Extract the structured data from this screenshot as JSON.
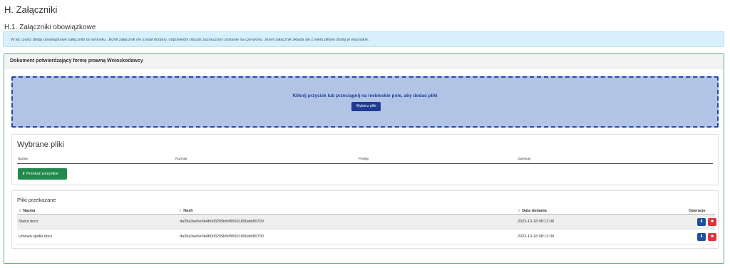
{
  "section": {
    "title": "H. Załączniki",
    "subtitle": "H.1. Załączniki obowiązkowe",
    "info": "W tej części dodaj obowiązkowe załączniki do wniosku. Jeżeli załącznik nie został dodany, odpowiedni obszar zaznaczony zostanie na czerwono. Jeżeli załącznik składa się z wielu plików dodaj je wszystkie."
  },
  "document": {
    "title": "Dokument potwierdzający formę prawną Wnioskodawcy",
    "dropzone_text": "Kliknij przycisk lub przeciągnij na niebieskie pole, aby dodać pliki",
    "choose_button": "Wybierz pliki"
  },
  "selected_files": {
    "title": "Wybrane pliki",
    "columns": [
      "Nazwa",
      "Rozmiar",
      "Postęp",
      "Operacje"
    ],
    "send_all_button": "Przekaż wszystkie"
  },
  "sent_files": {
    "title": "Pliki przekazane",
    "columns": [
      "Nazwa",
      "Hash",
      "Data dodania",
      "Operacje"
    ],
    "rows": [
      {
        "name": "Statut.docx",
        "hash": "da39a3ee5e6b4b0d3255bfef95601890afd80709",
        "date": "2023-10-18 08:12:08"
      },
      {
        "name": "Umowa spółki.docx",
        "hash": "da39a3ee5e6b4b0d3255bfef95601890afd80709",
        "date": "2023-10-18 08:12:09"
      }
    ]
  },
  "icons": {
    "upload": "upload-icon",
    "sort": "sort-icon",
    "download": "download-icon",
    "delete": "trash-icon"
  },
  "colors": {
    "info_bg": "#d8f0fb",
    "card_border": "#5fae7d",
    "dropzone_bg": "#b1c4e6",
    "dropzone_border": "#2445a6",
    "primary": "#1e3a92",
    "success": "#1f8a4b",
    "danger": "#d9343f"
  }
}
